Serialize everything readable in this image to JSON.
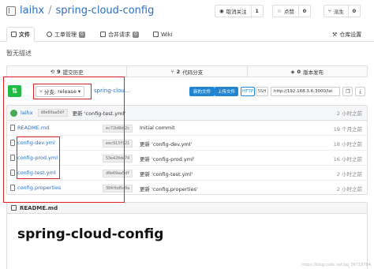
{
  "repo": {
    "owner": "laihx",
    "separator": "/",
    "name": "spring-cloud-config",
    "description": "暂无描述"
  },
  "header_actions": [
    {
      "label": "取消关注",
      "count": "1",
      "icon": "eye-icon"
    },
    {
      "label": "点赞",
      "count": "0",
      "icon": "star-icon"
    },
    {
      "label": "派生",
      "count": "0",
      "icon": "fork-icon"
    }
  ],
  "tabs": [
    {
      "label": "文件",
      "badge": ""
    },
    {
      "label": "工单管理",
      "badge": "0"
    },
    {
      "label": "合并请求",
      "badge": "0"
    },
    {
      "label": "Wiki",
      "badge": ""
    },
    {
      "label": "仓库设置",
      "badge": ""
    }
  ],
  "stats": [
    {
      "value": "9",
      "label": "提交历史"
    },
    {
      "value": "2",
      "label": "代码分支"
    },
    {
      "value": "0",
      "label": "版本发布"
    }
  ],
  "toolbar": {
    "branch_prefix": "分支:",
    "branch": "release",
    "breadcrumb": "spring-clou...",
    "new_file": "新的文件",
    "upload": "上传文件",
    "http": "HTTP",
    "ssh": "SSH",
    "clone_url": "http://192.168.3.6:3000/lai"
  },
  "latest_commit": {
    "author": "laihx",
    "sha": "d0e69aa5df",
    "message": "更新 'config-test.yml'",
    "time": "2 小时之前"
  },
  "files": [
    {
      "name": "README.md",
      "sha": "ec72b8bb2c",
      "message": "Initial commit",
      "time": "19 个月之前"
    },
    {
      "name": "config-dev.yml",
      "sha": "eec913f921",
      "message": "更新 'config-dev.yml'",
      "time": "18 小时之前"
    },
    {
      "name": "config-prod.yml",
      "sha": "53e420de74",
      "message": "更新 'config-prod.yml'",
      "time": "16 小时之前"
    },
    {
      "name": "config-test.yml",
      "sha": "d0e69aa5df",
      "message": "更新 'config-test.yml'",
      "time": "2 小时之前"
    },
    {
      "name": "config.properties",
      "sha": "304fbd5d0a",
      "message": "更新 'config.properties'",
      "time": "2 小时之前"
    }
  ],
  "readme": {
    "filename": "README.md",
    "heading": "spring-cloud-config"
  },
  "watermark": "https://blog.csdn.net/qq_36718784",
  "colors": {
    "accent": "#2c6fbf",
    "new_button": "#21ba45",
    "primary_button": "#2185d0",
    "annotation": "#e02020"
  }
}
